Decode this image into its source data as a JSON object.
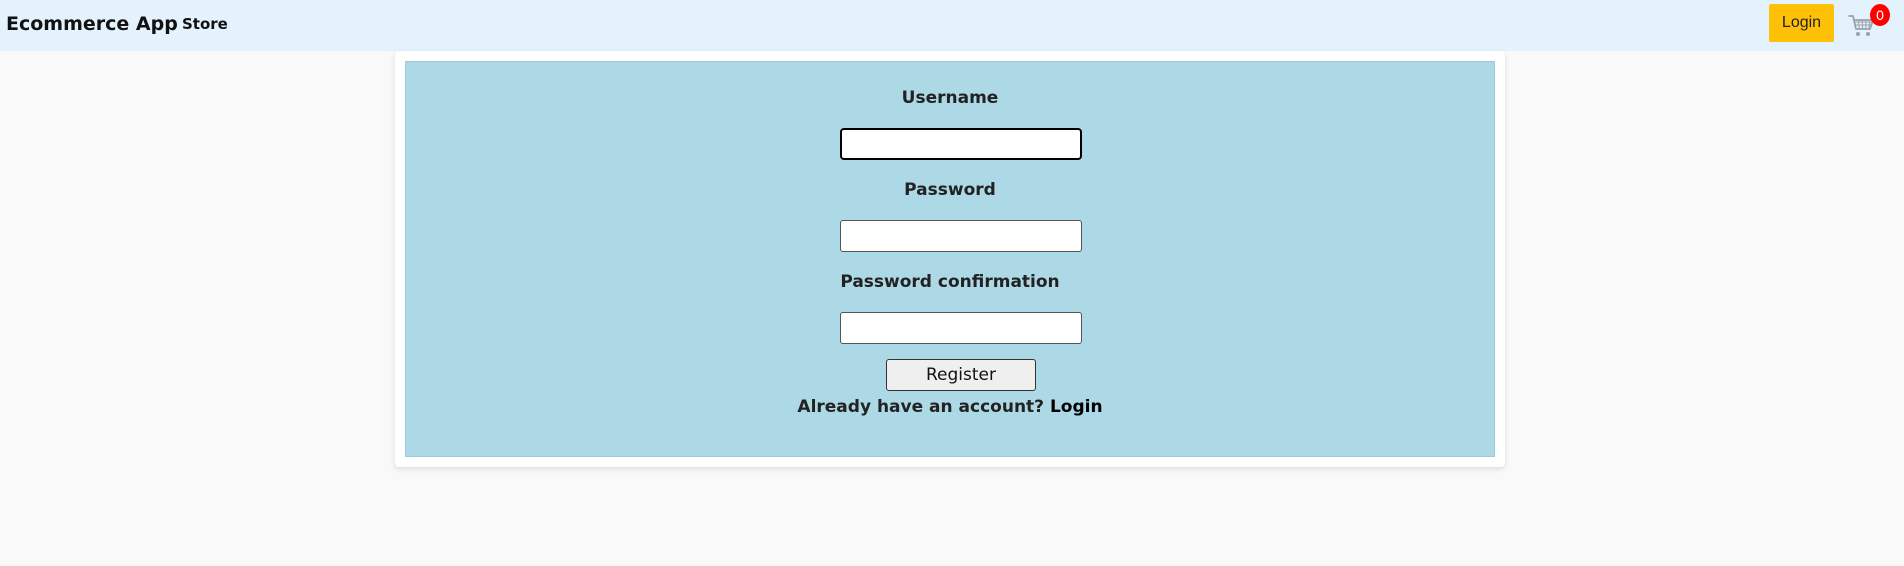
{
  "navbar": {
    "brand": "Ecommerce App",
    "store_link": "Store",
    "login_button": "Login",
    "cart_icon": "shopping-cart-icon",
    "cart_count": "0"
  },
  "form": {
    "username_label": "Username",
    "username_value": "",
    "password_label": "Password",
    "password_value": "",
    "password_confirmation_label": "Password confirmation",
    "password_confirmation_value": "",
    "register_button": "Register",
    "account_prompt": "Already have an account? ",
    "login_link": "Login"
  },
  "colors": {
    "navbar_bg": "#e3f2fd",
    "login_button_bg": "#ffc107",
    "form_panel_bg": "#add8e6",
    "badge_bg": "#ff0000"
  }
}
